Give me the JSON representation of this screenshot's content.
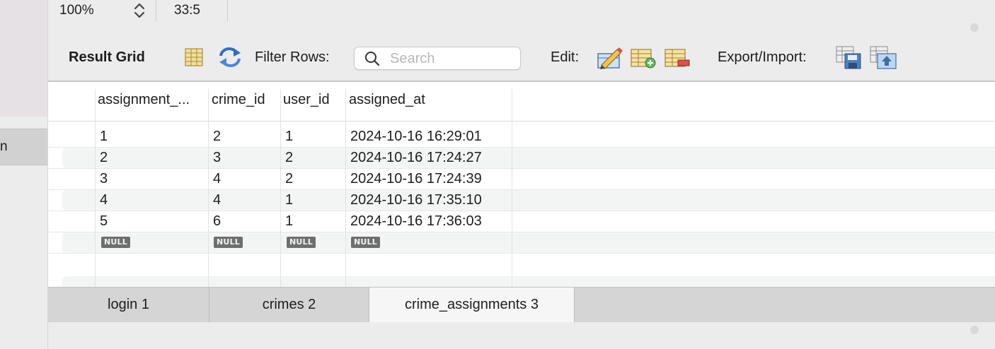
{
  "sidebar": {
    "item_label": "n"
  },
  "statusbar": {
    "zoom": "100%",
    "cursor_position": "33:5"
  },
  "toolbar": {
    "title": "Result Grid",
    "filter_label": "Filter Rows:",
    "search_placeholder": "Search",
    "edit_label": "Edit:",
    "export_label": "Export/Import:"
  },
  "grid": {
    "columns": [
      "assignment_...",
      "crime_id",
      "user_id",
      "assigned_at"
    ],
    "rows": [
      [
        "1",
        "2",
        "1",
        "2024-10-16 16:29:01"
      ],
      [
        "2",
        "3",
        "2",
        "2024-10-16 17:24:27"
      ],
      [
        "3",
        "4",
        "2",
        "2024-10-16 17:24:39"
      ],
      [
        "4",
        "4",
        "1",
        "2024-10-16 17:35:10"
      ],
      [
        "5",
        "6",
        "1",
        "2024-10-16 17:36:03"
      ]
    ],
    "null_label": "NULL"
  },
  "tabs": [
    {
      "label": "login 1",
      "active": false
    },
    {
      "label": "crimes 2",
      "active": false
    },
    {
      "label": "crime_assignments 3",
      "active": true
    }
  ],
  "colors": {
    "null_badge": "#6e6e6e",
    "active_tab": "#f6f6f6",
    "tab_bar": "#d5d5d5"
  }
}
